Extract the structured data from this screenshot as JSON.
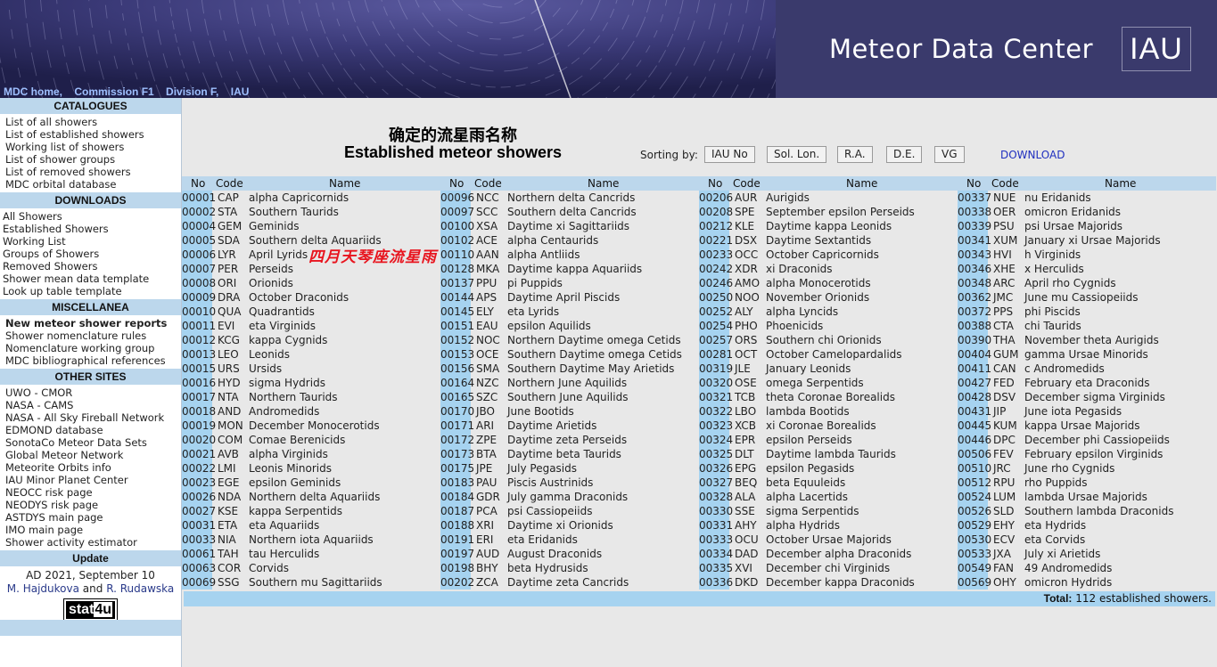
{
  "header": {
    "title": "Meteor Data Center",
    "logo_text": "IAU",
    "nav": [
      "MDC home,",
      "Commission F1",
      "Division F,",
      "IAU"
    ]
  },
  "sidebar": {
    "catalogues_title": "CATALOGUES",
    "catalogues": [
      "List of all showers",
      "List of established showers",
      "Working list of showers",
      "List of shower groups",
      "List of removed showers",
      "MDC orbital database"
    ],
    "downloads_title": "DOWNLOADS",
    "downloads": [
      "All Showers",
      "Established Showers",
      "Working List",
      "Groups of Showers",
      "Removed Showers",
      "Shower mean data template",
      "Look up table template"
    ],
    "misc_title": "MISCELLANEA",
    "misc": [
      "New meteor shower reports",
      "Shower nomenclature rules",
      "Nomenclature working group",
      "MDC bibliographical references"
    ],
    "other_title": "OTHER SITES",
    "other": [
      "UWO - CMOR",
      "NASA - CAMS",
      "NASA - All Sky Fireball Network",
      "EDMOND database",
      "SonotaCo Meteor Data Sets",
      "Global Meteor Network",
      "Meteorite Orbits info",
      "IAU Minor Planet Center",
      "NEOCC risk page",
      "NEODYS risk page",
      "ASTDYS main page",
      "IMO main page",
      "Shower activity estimator"
    ],
    "update_title": "Update",
    "update_date": "AD 2021, September 10",
    "author1": "M. Hajdukova",
    "and": "and",
    "author2": "R. Rudawska",
    "stat_a": "stat",
    "stat_b": "4u"
  },
  "main": {
    "title_cn": "确定的流星雨名称",
    "title_en": "Established meteor showers",
    "sort_label": "Sorting by:",
    "sort_buttons": [
      "IAU No",
      "Sol. Lon.",
      "R.A.",
      "D.E.",
      "VG"
    ],
    "download": "DOWNLOAD",
    "headers": {
      "no": "No",
      "code": "Code",
      "name": "Name"
    },
    "annotation": "四月天琴座流星雨",
    "total_label": "Total:",
    "total_value": "112 established showers."
  },
  "showers": [
    [
      [
        "00001",
        "CAP",
        "alpha Capricornids"
      ],
      [
        "00002",
        "STA",
        "Southern Taurids"
      ],
      [
        "00004",
        "GEM",
        "Geminids"
      ],
      [
        "00005",
        "SDA",
        "Southern delta Aquariids"
      ],
      [
        "00006",
        "LYR",
        "April Lyrids"
      ],
      [
        "00007",
        "PER",
        "Perseids"
      ],
      [
        "00008",
        "ORI",
        "Orionids"
      ],
      [
        "00009",
        "DRA",
        "October Draconids"
      ],
      [
        "00010",
        "QUA",
        "Quadrantids"
      ],
      [
        "00011",
        "EVI",
        "eta Virginids"
      ],
      [
        "00012",
        "KCG",
        "kappa Cygnids"
      ],
      [
        "00013",
        "LEO",
        "Leonids"
      ],
      [
        "00015",
        "URS",
        "Ursids"
      ],
      [
        "00016",
        "HYD",
        "sigma Hydrids"
      ],
      [
        "00017",
        "NTA",
        "Northern Taurids"
      ],
      [
        "00018",
        "AND",
        "Andromedids"
      ],
      [
        "00019",
        "MON",
        "December Monocerotids"
      ],
      [
        "00020",
        "COM",
        "Comae Berenicids"
      ],
      [
        "00021",
        "AVB",
        "alpha Virginids"
      ],
      [
        "00022",
        "LMI",
        "Leonis Minorids"
      ],
      [
        "00023",
        "EGE",
        "epsilon Geminids"
      ],
      [
        "00026",
        "NDA",
        "Northern delta Aquariids"
      ],
      [
        "00027",
        "KSE",
        "kappa Serpentids"
      ],
      [
        "00031",
        "ETA",
        "eta Aquariids"
      ],
      [
        "00033",
        "NIA",
        "Northern iota Aquariids"
      ],
      [
        "00061",
        "TAH",
        "tau Herculids"
      ],
      [
        "00063",
        "COR",
        "Corvids"
      ],
      [
        "00069",
        "SSG",
        "Southern mu Sagittariids"
      ]
    ],
    [
      [
        "00096",
        "NCC",
        "Northern delta Cancrids"
      ],
      [
        "00097",
        "SCC",
        "Southern delta Cancrids"
      ],
      [
        "00100",
        "XSA",
        "Daytime xi Sagittariids"
      ],
      [
        "00102",
        "ACE",
        "alpha Centaurids"
      ],
      [
        "00110",
        "AAN",
        "alpha Antliids"
      ],
      [
        "00128",
        "MKA",
        "Daytime kappa Aquariids"
      ],
      [
        "00137",
        "PPU",
        "pi Puppids"
      ],
      [
        "00144",
        "APS",
        "Daytime April Piscids"
      ],
      [
        "00145",
        "ELY",
        "eta Lyrids"
      ],
      [
        "00151",
        "EAU",
        "epsilon Aquilids"
      ],
      [
        "00152",
        "NOC",
        "Northern Daytime omega Cetids"
      ],
      [
        "00153",
        "OCE",
        "Southern Daytime omega Cetids"
      ],
      [
        "00156",
        "SMA",
        "Southern Daytime May Arietids"
      ],
      [
        "00164",
        "NZC",
        "Northern June Aquilids"
      ],
      [
        "00165",
        "SZC",
        "Southern June Aquilids"
      ],
      [
        "00170",
        "JBO",
        "June Bootids"
      ],
      [
        "00171",
        "ARI",
        "Daytime Arietids"
      ],
      [
        "00172",
        "ZPE",
        "Daytime zeta Perseids"
      ],
      [
        "00173",
        "BTA",
        "Daytime beta Taurids"
      ],
      [
        "00175",
        "JPE",
        "July Pegasids"
      ],
      [
        "00183",
        "PAU",
        "Piscis Austrinids"
      ],
      [
        "00184",
        "GDR",
        "July gamma Draconids"
      ],
      [
        "00187",
        "PCA",
        "psi Cassiopeiids"
      ],
      [
        "00188",
        "XRI",
        "Daytime xi Orionids"
      ],
      [
        "00191",
        "ERI",
        "eta Eridanids"
      ],
      [
        "00197",
        "AUD",
        "August Draconids"
      ],
      [
        "00198",
        "BHY",
        "beta Hydrusids"
      ],
      [
        "00202",
        "ZCA",
        "Daytime zeta Cancrids"
      ]
    ],
    [
      [
        "00206",
        "AUR",
        "Aurigids"
      ],
      [
        "00208",
        "SPE",
        "September epsilon Perseids"
      ],
      [
        "00212",
        "KLE",
        "Daytime kappa Leonids"
      ],
      [
        "00221",
        "DSX",
        "Daytime Sextantids"
      ],
      [
        "00233",
        "OCC",
        "October Capricornids"
      ],
      [
        "00242",
        "XDR",
        "xi Draconids"
      ],
      [
        "00246",
        "AMO",
        "alpha Monocerotids"
      ],
      [
        "00250",
        "NOO",
        "November Orionids"
      ],
      [
        "00252",
        "ALY",
        "alpha Lyncids"
      ],
      [
        "00254",
        "PHO",
        "Phoenicids"
      ],
      [
        "00257",
        "ORS",
        "Southern chi Orionids"
      ],
      [
        "00281",
        "OCT",
        "October Camelopardalids"
      ],
      [
        "00319",
        "JLE",
        "January Leonids"
      ],
      [
        "00320",
        "OSE",
        "omega Serpentids"
      ],
      [
        "00321",
        "TCB",
        "theta Coronae Borealids"
      ],
      [
        "00322",
        "LBO",
        "lambda Bootids"
      ],
      [
        "00323",
        "XCB",
        "xi Coronae Borealids"
      ],
      [
        "00324",
        "EPR",
        "epsilon Perseids"
      ],
      [
        "00325",
        "DLT",
        "Daytime lambda Taurids"
      ],
      [
        "00326",
        "EPG",
        "epsilon Pegasids"
      ],
      [
        "00327",
        "BEQ",
        "beta Equuleids"
      ],
      [
        "00328",
        "ALA",
        "alpha Lacertids"
      ],
      [
        "00330",
        "SSE",
        "sigma Serpentids"
      ],
      [
        "00331",
        "AHY",
        "alpha Hydrids"
      ],
      [
        "00333",
        "OCU",
        "October Ursae Majorids"
      ],
      [
        "00334",
        "DAD",
        "December alpha Draconids"
      ],
      [
        "00335",
        "XVI",
        "December chi Virginids"
      ],
      [
        "00336",
        "DKD",
        "December kappa Draconids"
      ]
    ],
    [
      [
        "00337",
        "NUE",
        "nu Eridanids"
      ],
      [
        "00338",
        "OER",
        "omicron Eridanids"
      ],
      [
        "00339",
        "PSU",
        "psi Ursae Majorids"
      ],
      [
        "00341",
        "XUM",
        "January xi Ursae Majorids"
      ],
      [
        "00343",
        "HVI",
        "h Virginids"
      ],
      [
        "00346",
        "XHE",
        "x Herculids"
      ],
      [
        "00348",
        "ARC",
        "April rho Cygnids"
      ],
      [
        "00362",
        "JMC",
        "June mu Cassiopeiids"
      ],
      [
        "00372",
        "PPS",
        "phi Piscids"
      ],
      [
        "00388",
        "CTA",
        "chi Taurids"
      ],
      [
        "00390",
        "THA",
        "November theta Aurigids"
      ],
      [
        "00404",
        "GUM",
        "gamma Ursae Minorids"
      ],
      [
        "00411",
        "CAN",
        "c Andromedids"
      ],
      [
        "00427",
        "FED",
        "February eta Draconids"
      ],
      [
        "00428",
        "DSV",
        "December sigma Virginids"
      ],
      [
        "00431",
        "JIP",
        "June iota Pegasids"
      ],
      [
        "00445",
        "KUM",
        "kappa Ursae Majorids"
      ],
      [
        "00446",
        "DPC",
        "December phi Cassiopeiids"
      ],
      [
        "00506",
        "FEV",
        "February epsilon Virginids"
      ],
      [
        "00510",
        "JRC",
        "June rho Cygnids"
      ],
      [
        "00512",
        "RPU",
        "rho Puppids"
      ],
      [
        "00524",
        "LUM",
        "lambda Ursae Majorids"
      ],
      [
        "00526",
        "SLD",
        "Southern lambda Draconids"
      ],
      [
        "00529",
        "EHY",
        "eta Hydrids"
      ],
      [
        "00530",
        "ECV",
        "eta Corvids"
      ],
      [
        "00533",
        "JXA",
        "July xi Arietids"
      ],
      [
        "00549",
        "FAN",
        "49 Andromedids"
      ],
      [
        "00569",
        "OHY",
        "omicron Hydrids"
      ]
    ]
  ],
  "colors": {
    "header_bg": "#3a3a6c",
    "section_bg": "#bcd7ec",
    "number_cell_bg": "#a6d3f0",
    "main_bg": "#e8e8e8",
    "annotation": "#e8141e",
    "link": "#1f2fbf"
  }
}
